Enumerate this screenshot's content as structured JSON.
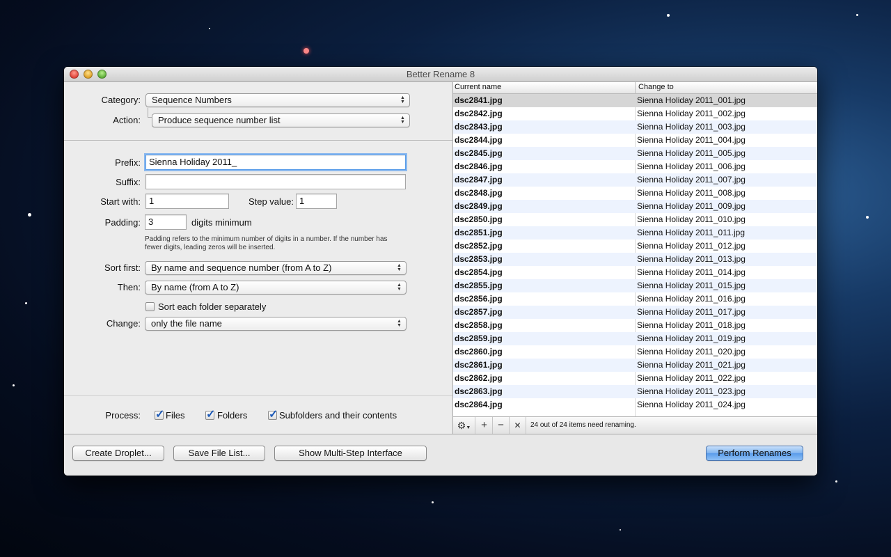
{
  "window": {
    "title": "Better Rename 8"
  },
  "form": {
    "category_label": "Category:",
    "category_value": "Sequence Numbers",
    "action_label": "Action:",
    "action_value": "Produce sequence number list",
    "prefix_label": "Prefix:",
    "prefix_value": "Sienna Holiday 2011_",
    "suffix_label": "Suffix:",
    "suffix_value": "",
    "start_label": "Start with:",
    "start_value": "1",
    "step_label": "Step value:",
    "step_value": "1",
    "padding_label": "Padding:",
    "padding_value": "3",
    "padding_suffix": "digits minimum",
    "padding_note": "Padding refers to the minimum number of digits in a number. If the number has fewer digits, leading zeros will be inserted.",
    "sort_first_label": "Sort first:",
    "sort_first_value": "By name and sequence number (from A to Z)",
    "then_label": "Then:",
    "then_value": "By name (from A to Z)",
    "sort_each_label": "Sort each folder separately",
    "sort_each_checked": false,
    "change_label": "Change:",
    "change_value": "only the file name"
  },
  "process": {
    "label": "Process:",
    "files_label": "Files",
    "files_checked": true,
    "folders_label": "Folders",
    "folders_checked": true,
    "subfolders_label": "Subfolders and their contents",
    "subfolders_checked": true
  },
  "table": {
    "columns": [
      "Current name",
      "Change to"
    ],
    "rows": [
      [
        "dsc2841.jpg",
        "Sienna Holiday 2011_001.jpg"
      ],
      [
        "dsc2842.jpg",
        "Sienna Holiday 2011_002.jpg"
      ],
      [
        "dsc2843.jpg",
        "Sienna Holiday 2011_003.jpg"
      ],
      [
        "dsc2844.jpg",
        "Sienna Holiday 2011_004.jpg"
      ],
      [
        "dsc2845.jpg",
        "Sienna Holiday 2011_005.jpg"
      ],
      [
        "dsc2846.jpg",
        "Sienna Holiday 2011_006.jpg"
      ],
      [
        "dsc2847.jpg",
        "Sienna Holiday 2011_007.jpg"
      ],
      [
        "dsc2848.jpg",
        "Sienna Holiday 2011_008.jpg"
      ],
      [
        "dsc2849.jpg",
        "Sienna Holiday 2011_009.jpg"
      ],
      [
        "dsc2850.jpg",
        "Sienna Holiday 2011_010.jpg"
      ],
      [
        "dsc2851.jpg",
        "Sienna Holiday 2011_011.jpg"
      ],
      [
        "dsc2852.jpg",
        "Sienna Holiday 2011_012.jpg"
      ],
      [
        "dsc2853.jpg",
        "Sienna Holiday 2011_013.jpg"
      ],
      [
        "dsc2854.jpg",
        "Sienna Holiday 2011_014.jpg"
      ],
      [
        "dsc2855.jpg",
        "Sienna Holiday 2011_015.jpg"
      ],
      [
        "dsc2856.jpg",
        "Sienna Holiday 2011_016.jpg"
      ],
      [
        "dsc2857.jpg",
        "Sienna Holiday 2011_017.jpg"
      ],
      [
        "dsc2858.jpg",
        "Sienna Holiday 2011_018.jpg"
      ],
      [
        "dsc2859.jpg",
        "Sienna Holiday 2011_019.jpg"
      ],
      [
        "dsc2860.jpg",
        "Sienna Holiday 2011_020.jpg"
      ],
      [
        "dsc2861.jpg",
        "Sienna Holiday 2011_021.jpg"
      ],
      [
        "dsc2862.jpg",
        "Sienna Holiday 2011_022.jpg"
      ],
      [
        "dsc2863.jpg",
        "Sienna Holiday 2011_023.jpg"
      ],
      [
        "dsc2864.jpg",
        "Sienna Holiday 2011_024.jpg"
      ]
    ],
    "status": "24 out of 24 items need renaming.",
    "gear_icon": "gear-icon",
    "add_symbol": "+",
    "remove_symbol": "−",
    "clear_symbol": "✕"
  },
  "buttons": {
    "create_droplet": "Create Droplet...",
    "save_file_list": "Save File List...",
    "multi_step": "Show Multi-Step Interface",
    "perform": "Perform Renames"
  }
}
